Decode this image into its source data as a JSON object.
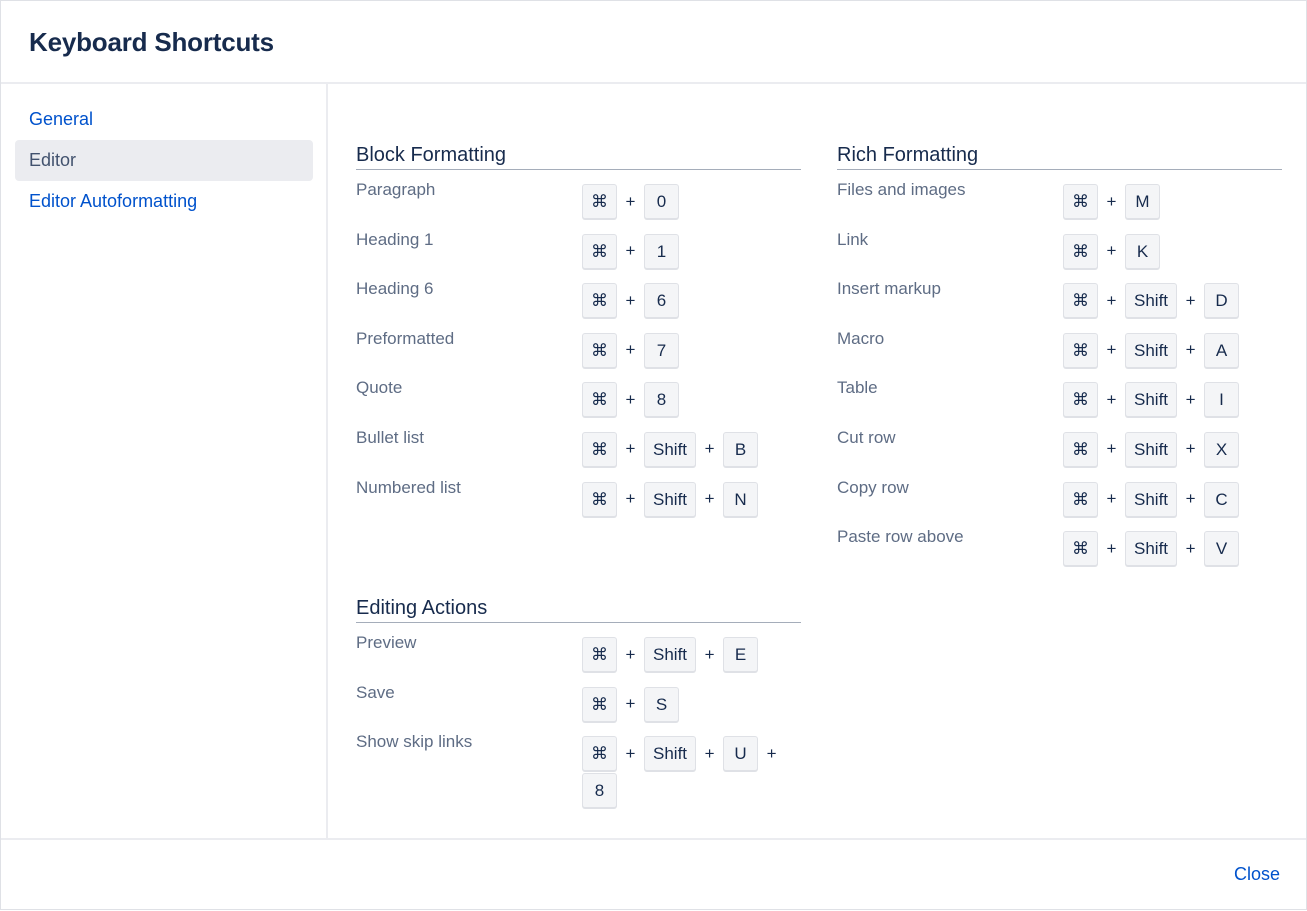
{
  "dialog": {
    "title": "Keyboard Shortcuts",
    "close_label": "Close"
  },
  "sidebar": {
    "items": [
      {
        "label": "General",
        "active": false
      },
      {
        "label": "Editor",
        "active": true
      },
      {
        "label": "Editor Autoformatting",
        "active": false
      }
    ]
  },
  "sections": {
    "block": {
      "title": "Block Formatting",
      "rows": [
        {
          "label": "Paragraph",
          "keys": [
            "⌘",
            "0"
          ]
        },
        {
          "label": "Heading 1",
          "keys": [
            "⌘",
            "1"
          ]
        },
        {
          "label": "Heading 6",
          "keys": [
            "⌘",
            "6"
          ]
        },
        {
          "label": "Preformatted",
          "keys": [
            "⌘",
            "7"
          ]
        },
        {
          "label": "Quote",
          "keys": [
            "⌘",
            "8"
          ]
        },
        {
          "label": "Bullet list",
          "keys": [
            "⌘",
            "Shift",
            "B"
          ]
        },
        {
          "label": "Numbered list",
          "keys": [
            "⌘",
            "Shift",
            "N"
          ]
        }
      ]
    },
    "editing": {
      "title": "Editing Actions",
      "rows": [
        {
          "label": "Preview",
          "keys": [
            "⌘",
            "Shift",
            "E"
          ]
        },
        {
          "label": "Save",
          "keys": [
            "⌘",
            "S"
          ]
        },
        {
          "label": "Show skip links",
          "keys": [
            "⌘",
            "Shift",
            "U",
            "8"
          ]
        }
      ]
    },
    "rich": {
      "title": "Rich Formatting",
      "rows": [
        {
          "label": "Files and images",
          "keys": [
            "⌘",
            "M"
          ]
        },
        {
          "label": "Link",
          "keys": [
            "⌘",
            "K"
          ]
        },
        {
          "label": "Insert markup",
          "keys": [
            "⌘",
            "Shift",
            "D"
          ]
        },
        {
          "label": "Macro",
          "keys": [
            "⌘",
            "Shift",
            "A"
          ]
        },
        {
          "label": "Table",
          "keys": [
            "⌘",
            "Shift",
            "I"
          ]
        },
        {
          "label": "Cut row",
          "keys": [
            "⌘",
            "Shift",
            "X"
          ]
        },
        {
          "label": "Copy row",
          "keys": [
            "⌘",
            "Shift",
            "C"
          ]
        },
        {
          "label": "Paste row above",
          "keys": [
            "⌘",
            "Shift",
            "V"
          ]
        }
      ]
    }
  },
  "plus_symbol": "+"
}
